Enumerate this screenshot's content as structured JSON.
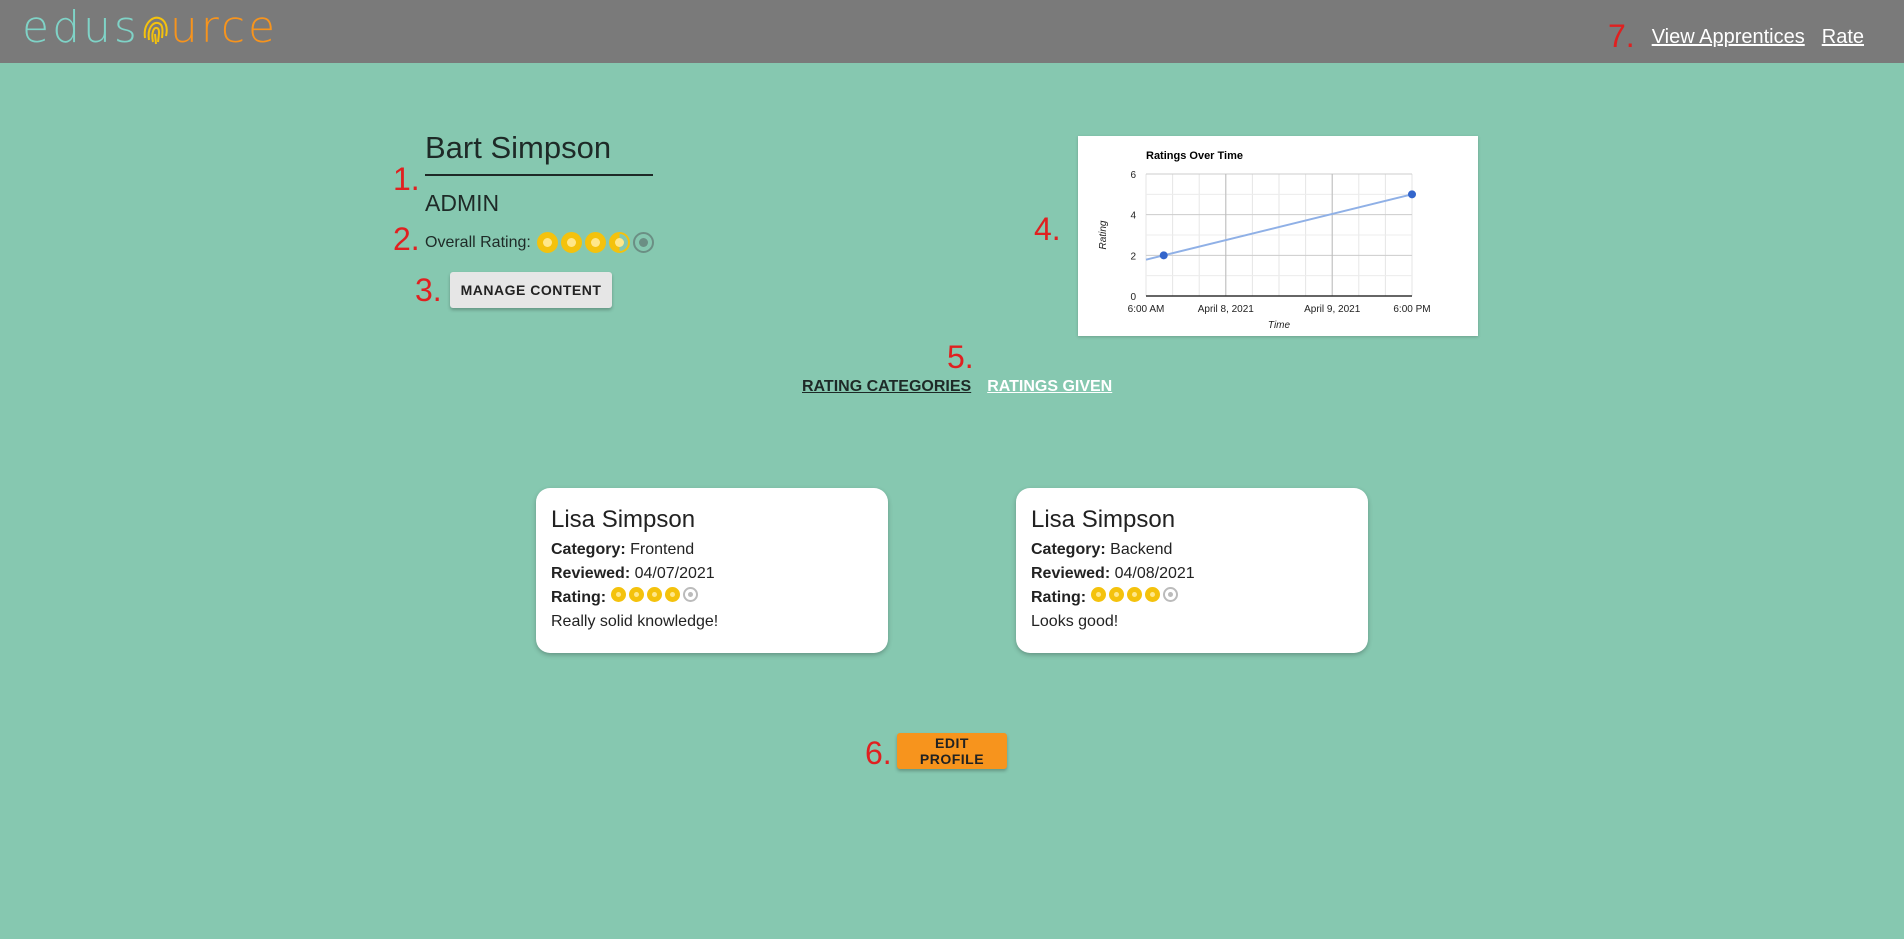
{
  "logo": {
    "part1": "edus",
    "part2": "urce"
  },
  "nav": {
    "view_apprentices": "View Apprentices",
    "rate": "Rate"
  },
  "markers": [
    "1.",
    "2.",
    "3.",
    "4.",
    "5.",
    "6.",
    "7."
  ],
  "profile": {
    "name": "Bart Simpson",
    "role": "ADMIN",
    "overall_label": "Overall Rating:",
    "overall_rating": 3.5,
    "overall_max": 5,
    "manage_label": "MANAGE CONTENT"
  },
  "tabs": {
    "categories": "RATING CATEGORIES",
    "given": "RATINGS GIVEN"
  },
  "cards": [
    {
      "name": "Lisa Simpson",
      "category_label": "Category:",
      "category": "Frontend",
      "reviewed_label": "Reviewed:",
      "reviewed": "04/07/2021",
      "rating_label": "Rating:",
      "rating": 4,
      "comment": "Really solid knowledge!"
    },
    {
      "name": "Lisa Simpson",
      "category_label": "Category:",
      "category": "Backend",
      "reviewed_label": "Reviewed:",
      "reviewed": "04/08/2021",
      "rating_label": "Rating:",
      "rating": 4,
      "comment": "Looks good!"
    }
  ],
  "edit_label": "EDIT PROFILE",
  "colors": {
    "background": "#86c8b0",
    "topbar": "#7a7a7a",
    "accent": "#f7941d",
    "marker": "#e02020",
    "line": "#3366cc"
  },
  "chart_data": {
    "type": "line",
    "title": "Ratings Over Time",
    "xlabel": "Time",
    "ylabel": "Rating",
    "x_ticks": [
      "6:00 AM",
      "April 8, 2021",
      "April 9, 2021",
      "6:00 PM"
    ],
    "y_ticks": [
      0,
      2,
      4,
      6
    ],
    "ylim": [
      0,
      6
    ],
    "xlim": [
      "2021-04-07T06:00",
      "2021-04-09T18:00"
    ],
    "series": [
      {
        "points": [
          {
            "x": "2021-04-07T10:00",
            "y": 2
          },
          {
            "x": "2021-04-09T18:00",
            "y": 5
          }
        ]
      }
    ],
    "grid": true
  }
}
